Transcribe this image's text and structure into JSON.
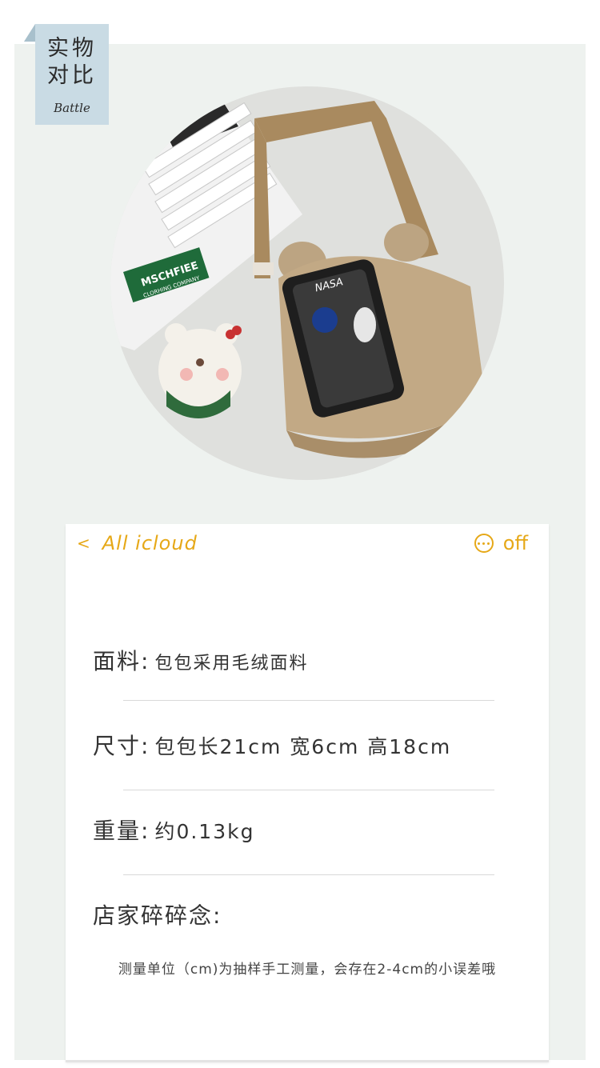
{
  "tag": {
    "title": "实物\n对比",
    "subtitle": "Battle"
  },
  "photo": {
    "description_icon": "product-photo",
    "keyboard_sticker_text": "MSCHFIEE",
    "keyboard_sticker_sub": "CLORHING COMPANY",
    "phone_brand": "NASA"
  },
  "nav": {
    "back_label": "All icloud",
    "back_chevron": "<",
    "right_label": "off"
  },
  "specs": [
    {
      "label": "面料",
      "separator": ":",
      "value": "包包采用毛绒面料"
    },
    {
      "label": "尺寸",
      "separator": ":",
      "value": "包包长21cm 宽6cm 高18cm"
    },
    {
      "label": "重量",
      "separator": ":",
      "value": "约0.13kg"
    },
    {
      "label": "店家碎碎念",
      "separator": ":",
      "value": ""
    }
  ],
  "note": "测量单位（cm)为抽样手工测量，会存在2-4cm的小误差哦",
  "colors": {
    "accent": "#e6a817",
    "tag_bg": "#c9dbe4",
    "page_bg": "#eef2ef"
  }
}
